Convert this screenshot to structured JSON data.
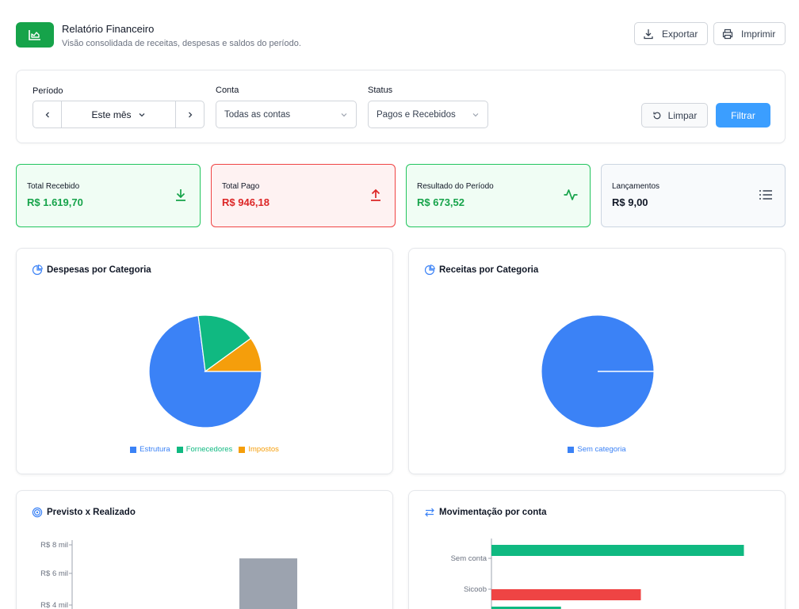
{
  "header": {
    "title": "Relatório Financeiro",
    "subtitle": "Visão consolidada de receitas, despesas e saldos do período.",
    "export_label": "Exportar",
    "print_label": "Imprimir",
    "logo_icon": "chart-area-icon"
  },
  "filters": {
    "period_label": "Período",
    "period_value": "Este mês",
    "account_label": "Conta",
    "account_value": "Todas as contas",
    "status_label": "Status",
    "status_value": "Pagos e Recebidos",
    "clear_label": "Limpar",
    "filter_label": "Filtrar"
  },
  "kpis": {
    "received": {
      "label": "Total Recebido",
      "value": "R$ 1.619,70",
      "color": "#16a34a",
      "bg": "#f0fdf4",
      "border": "#22c55e",
      "icon": "arrow-down-to-line-icon"
    },
    "paid": {
      "label": "Total Pago",
      "value": "R$ 946,18",
      "color": "#dc2626",
      "bg": "#fef2f2",
      "border": "#ef4444",
      "icon": "arrow-up-from-line-icon"
    },
    "result": {
      "label": "Resultado do Período",
      "value": "R$ 673,52",
      "color": "#16a34a",
      "bg": "#f0fdf4",
      "border": "#22c55e",
      "icon": "activity-icon"
    },
    "entries": {
      "label": "Lançamentos",
      "value": "R$ 9,00",
      "color": "#111827",
      "bg": "#f8fafc",
      "border": "#cbd5e1",
      "icon": "list-icon"
    }
  },
  "cards": {
    "expenses_title": "Despesas por Categoria",
    "income_title": "Receitas por Categoria",
    "planned_title": "Previsto x Realizado",
    "movement_title": "Movimentação por conta"
  },
  "chart_data": [
    {
      "type": "pie",
      "title": "Despesas por Categoria",
      "slices": [
        {
          "name": "Estrutura",
          "value": 0.73,
          "color": "#3b82f6"
        },
        {
          "name": "Fornecedores",
          "value": 0.17,
          "color": "#10b981"
        },
        {
          "name": "Impostos",
          "value": 0.1,
          "color": "#f59e0b"
        }
      ],
      "legend": "bottom"
    },
    {
      "type": "pie",
      "title": "Receitas por Categoria",
      "slices": [
        {
          "name": "Sem categoria",
          "value": 1.0,
          "color": "#3b82f6"
        }
      ],
      "legend": "bottom"
    },
    {
      "type": "bar",
      "title": "Previsto x Realizado",
      "y_ticks": [
        "R$ 8 mil",
        "R$ 6 mil",
        "R$ 4 mil"
      ],
      "ylim": [
        0,
        8
      ],
      "bars": [
        {
          "value": 7.1,
          "color": "#9ca3af"
        }
      ]
    },
    {
      "type": "bar",
      "orientation": "horizontal",
      "title": "Movimentação por conta",
      "categories": [
        "Sem conta",
        "Sicoob"
      ],
      "bars": [
        {
          "category": "Sem conta",
          "value": 0.98,
          "color": "#10b981"
        },
        {
          "category": "Sicoob",
          "value": 0.58,
          "color": "#ef4444"
        },
        {
          "category": "",
          "value": 0.27,
          "color": "#10b981"
        }
      ]
    }
  ]
}
